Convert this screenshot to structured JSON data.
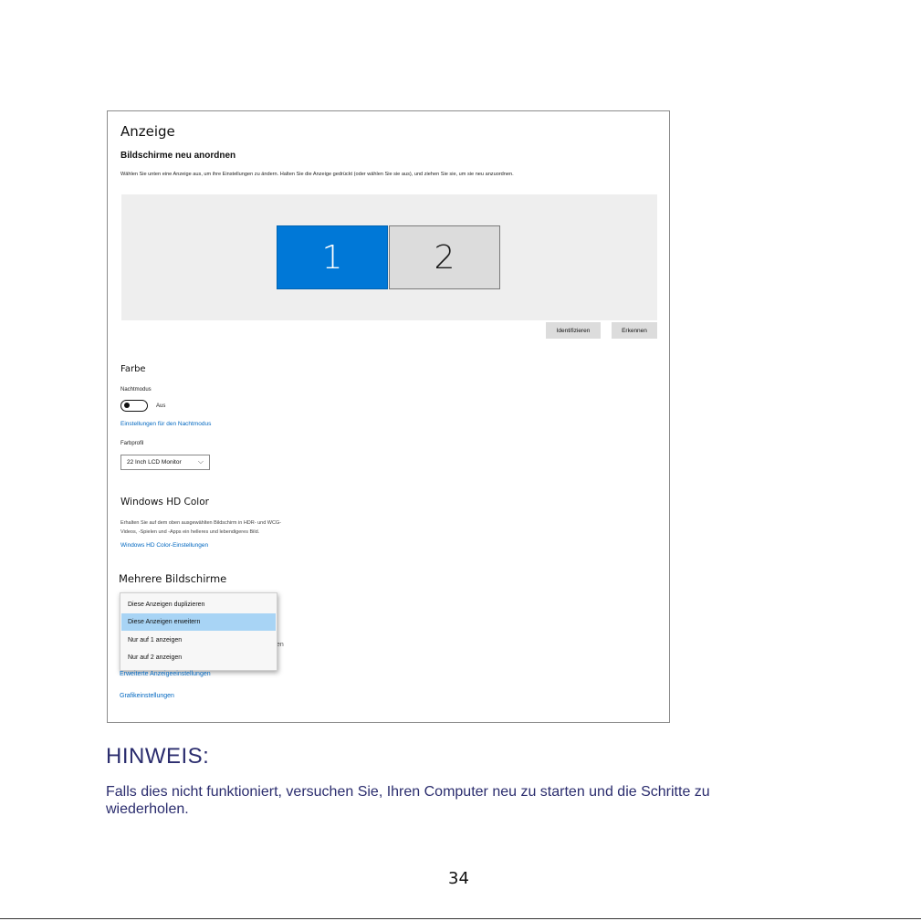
{
  "window": {
    "title": "Anzeige",
    "arrange_heading": "Bildschirme neu anordnen",
    "arrange_desc": "Wählen Sie unten eine Anzeige aus, um ihre Einstellungen zu ändern. Halten Sie die Anzeige gedrückt (oder wählen Sie sie aus), und ziehen Sie sie, um sie neu anzuordnen.",
    "monitors": [
      {
        "label": "1",
        "selected": true
      },
      {
        "label": "2",
        "selected": false
      }
    ],
    "identify_button": "Identifizieren",
    "detect_button": "Erkennen",
    "color_heading": "Farbe",
    "night_mode_label": "Nachtmodus",
    "night_mode_state": "Aus",
    "night_mode_link": "Einstellungen für den Nachtmodus",
    "color_profile_label": "Farbprofil",
    "color_profile_value": "22 Inch LCD Monitor",
    "hdr_heading": "Windows HD Color",
    "hdr_desc_line1": "Erhalten Sie auf dem oben ausgewählten Bildschirm in HDR- und WCG-",
    "hdr_desc_line2": "Videos, -Spielen und -Apps ein helleres und lebendigeres Bild.",
    "hdr_link": "Windows HD Color-Einstellungen",
    "multi_heading": "Mehrere Bildschirme",
    "dropdown_options": [
      "Diese Anzeigen duplizieren",
      "Diese Anzeigen erweitern",
      "Nur auf 1 anzeigen",
      "Nur auf 2 anzeigen"
    ],
    "dropdown_selected_index": 1,
    "obscured_fragment": "en",
    "advanced_link": "Erweiterte Anzeigeeinstellungen",
    "graphics_link": "Grafikeinstellungen"
  },
  "note": {
    "heading": "HINWEIS:",
    "text": "Falls dies nicht funktioniert, versuchen Sie, Ihren Computer neu zu starten und die Schritte zu wiederholen."
  },
  "page_number": "34",
  "colors": {
    "accent": "#0078d7",
    "link": "#0067c0",
    "note_text": "#2b2d6e"
  }
}
